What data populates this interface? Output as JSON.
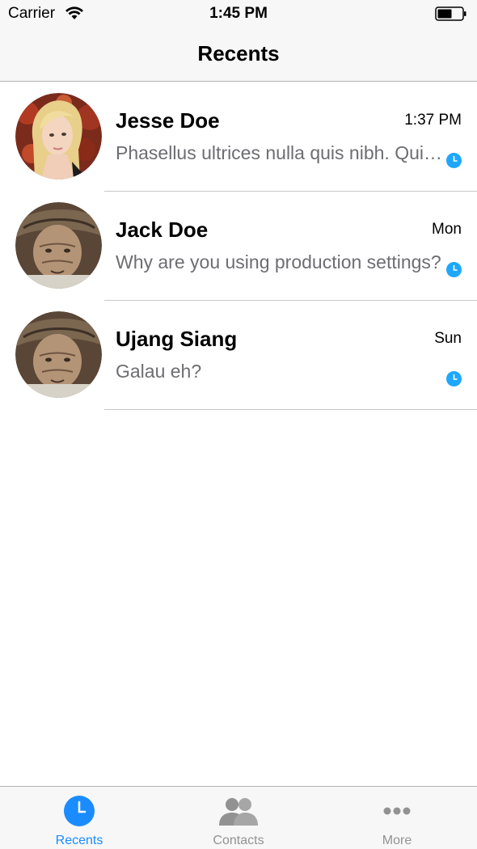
{
  "status_bar": {
    "carrier": "Carrier",
    "time": "1:45 PM"
  },
  "nav": {
    "title": "Recents"
  },
  "colors": {
    "accent": "#1a8cff",
    "status_dot": "#1ea7fd",
    "tab_inactive": "#929292"
  },
  "conversations": [
    {
      "name": "Jesse Doe",
      "time": "1:37 PM",
      "message": "Phasellus ultrices nulla quis nibh. Quisque a lectus.",
      "avatar": "blonde-woman-avatar",
      "status_icon": "clock-icon"
    },
    {
      "name": "Jack Doe",
      "time": "Mon",
      "message": "Why are you using production settings?",
      "avatar": "elderly-man-avatar",
      "status_icon": "clock-icon"
    },
    {
      "name": "Ujang Siang",
      "time": "Sun",
      "message": "Galau eh?",
      "avatar": "elderly-man-avatar",
      "status_icon": "clock-icon"
    }
  ],
  "tabs": [
    {
      "label": "Recents",
      "icon": "clock-icon",
      "active": true
    },
    {
      "label": "Contacts",
      "icon": "contacts-icon",
      "active": false
    },
    {
      "label": "More",
      "icon": "more-icon",
      "active": false
    }
  ]
}
